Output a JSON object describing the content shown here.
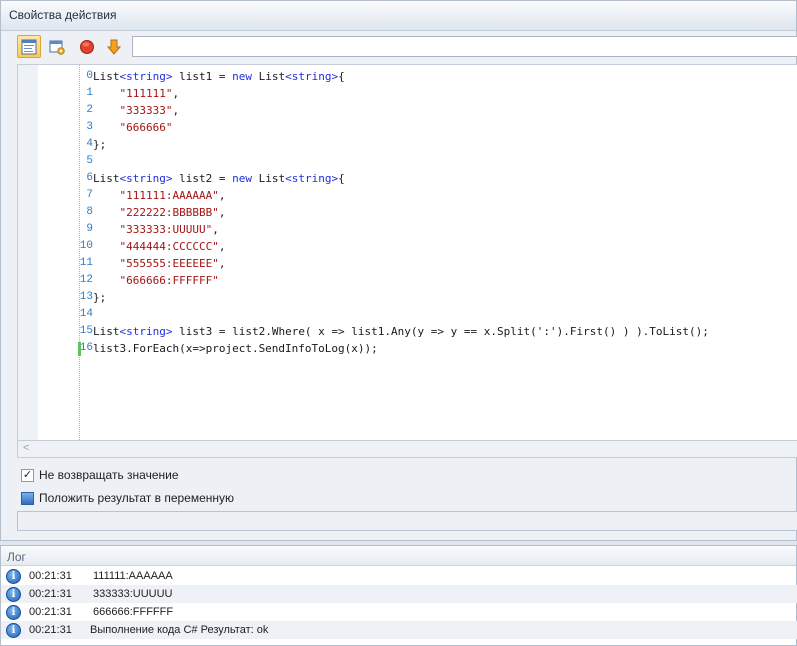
{
  "props_panel": {
    "title": "Свойства действия"
  },
  "toolbar": {
    "buttons": [
      {
        "icon": "code-view-icon",
        "active": true
      },
      {
        "icon": "settings-window-icon",
        "active": false
      },
      {
        "icon": "stop-icon",
        "active": false
      },
      {
        "icon": "arrow-down-icon",
        "active": false
      }
    ],
    "field_value": ""
  },
  "editor": {
    "line_numbers": [
      "0",
      "1",
      "2",
      "3",
      "4",
      "5",
      "6",
      "7",
      "8",
      "9",
      "10",
      "11",
      "12",
      "13",
      "14",
      "15",
      "16"
    ],
    "lines": [
      [
        [
          "t",
          "List"
        ],
        [
          "k",
          "<string>"
        ],
        [
          "t",
          " list1 = "
        ],
        [
          "k",
          "new"
        ],
        [
          "t",
          " List"
        ],
        [
          "k",
          "<string>"
        ],
        [
          "t",
          "{"
        ]
      ],
      [
        [
          "t",
          "    "
        ],
        [
          "s",
          "\"111111\""
        ],
        [
          "t",
          ","
        ]
      ],
      [
        [
          "t",
          "    "
        ],
        [
          "s",
          "\"333333\""
        ],
        [
          "t",
          ","
        ]
      ],
      [
        [
          "t",
          "    "
        ],
        [
          "s",
          "\"666666\""
        ]
      ],
      [
        [
          "t",
          "};"
        ]
      ],
      [],
      [
        [
          "t",
          "List"
        ],
        [
          "k",
          "<string>"
        ],
        [
          "t",
          " list2 = "
        ],
        [
          "k",
          "new"
        ],
        [
          "t",
          " List"
        ],
        [
          "k",
          "<string>"
        ],
        [
          "t",
          "{"
        ]
      ],
      [
        [
          "t",
          "    "
        ],
        [
          "s",
          "\"111111:AAAAAA\""
        ],
        [
          "t",
          ","
        ]
      ],
      [
        [
          "t",
          "    "
        ],
        [
          "s",
          "\"222222:BBBBBB\""
        ],
        [
          "t",
          ","
        ]
      ],
      [
        [
          "t",
          "    "
        ],
        [
          "s",
          "\"333333:UUUUU\""
        ],
        [
          "t",
          ","
        ]
      ],
      [
        [
          "t",
          "    "
        ],
        [
          "s",
          "\"444444:CCCCCC\""
        ],
        [
          "t",
          ","
        ]
      ],
      [
        [
          "t",
          "    "
        ],
        [
          "s",
          "\"555555:EEEEEE\""
        ],
        [
          "t",
          ","
        ]
      ],
      [
        [
          "t",
          "    "
        ],
        [
          "s",
          "\"666666:FFFFFF\""
        ]
      ],
      [
        [
          "t",
          "};"
        ]
      ],
      [],
      [
        [
          "t",
          "List"
        ],
        [
          "k",
          "<string>"
        ],
        [
          "t",
          " list3 = list2.Where( x => list1.Any(y => y == x.Split(':').First() ) ).ToList();"
        ]
      ],
      [
        [
          "t",
          "list3.ForEach(x=>project.SendInfoToLog(x));"
        ]
      ]
    ],
    "changed_line": 16
  },
  "options": {
    "no_return": {
      "label": "Не возвращать значение",
      "checked": true
    },
    "put_result": {
      "label": "Положить результат в переменную",
      "checked": false
    }
  },
  "result_field": {
    "value": ""
  },
  "log": {
    "title": "Лог",
    "rows": [
      {
        "time": "00:21:31",
        "message": "111111:AAAAAA"
      },
      {
        "time": "00:21:31",
        "message": "333333:UUUUU"
      },
      {
        "time": "00:21:31",
        "message": "666666:FFFFFF"
      },
      {
        "time": "00:21:31",
        "message": "Выполнение кода C#  Результат: ok"
      }
    ]
  },
  "colors": {
    "keyword": "#1f2fe0",
    "string": "#a31515",
    "line_number": "#2b7dc6",
    "change_marker": "#5cc45c"
  }
}
